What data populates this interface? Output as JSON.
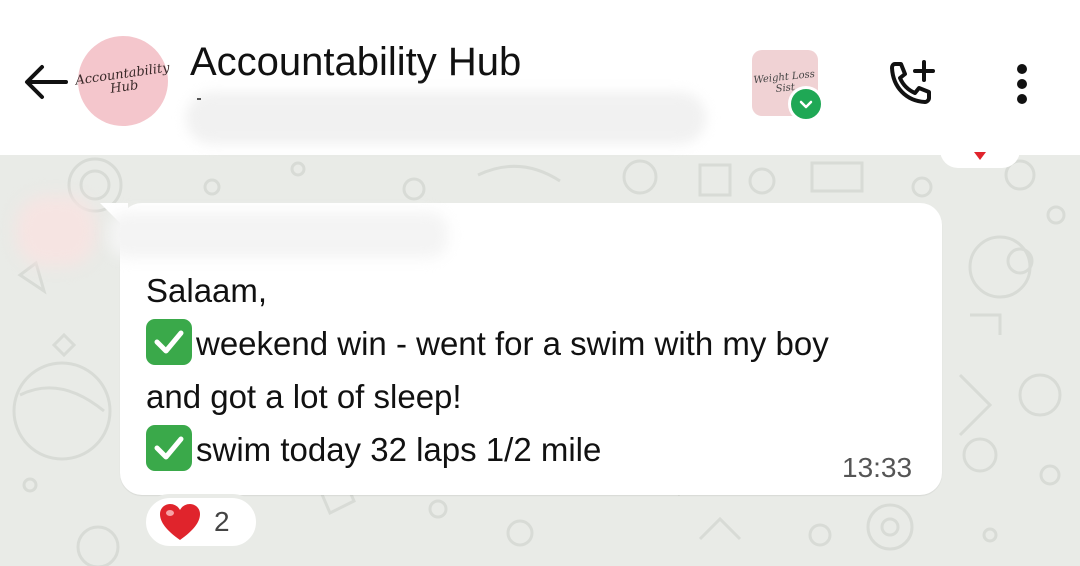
{
  "header": {
    "title": "Accountability Hub",
    "subtitle": "",
    "group_avatar_text": "Accountability Hub",
    "community_avatar_text": "Weight Loss Sist"
  },
  "icons": {
    "back": "arrow-left-icon",
    "call": "phone-add-icon",
    "more": "more-vertical-icon",
    "check": "check-mark-emoji-icon",
    "heart": "heart-emoji-icon"
  },
  "message": {
    "greeting": "Salaam,",
    "line1": "weekend win - went for a swim with my boy",
    "line2": "and got a lot of sleep!",
    "line3": "swim today 32 laps 1/2 mile",
    "time": "13:33"
  },
  "reaction": {
    "emoji": "❤️",
    "count": "2"
  },
  "colors": {
    "header_bg": "#ffffff",
    "chat_bg": "#e9ebe7",
    "bubble_bg": "#ffffff",
    "badge_green": "#1fa855",
    "check_green": "#3aa94a",
    "heart_red": "#e0242c"
  }
}
